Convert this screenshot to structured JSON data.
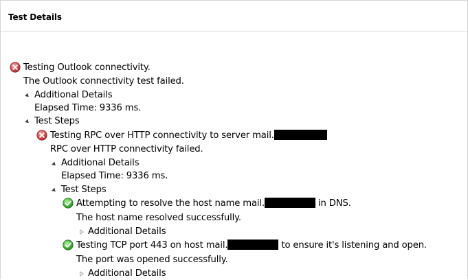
{
  "header": {
    "title": "Test Details"
  },
  "tree": {
    "root": {
      "title": "Testing Outlook connectivity.",
      "message": "The Outlook connectivity test failed.",
      "additional_details_label": "Additional Details",
      "elapsed": "Elapsed Time: 9336 ms.",
      "test_steps_label": "Test Steps",
      "status": "error"
    },
    "rpc": {
      "title_prefix": "Testing RPC over HTTP connectivity to server mail.",
      "message": "RPC over HTTP connectivity failed.",
      "additional_details_label": "Additional Details",
      "elapsed": "Elapsed Time: 9336 ms.",
      "test_steps_label": "Test Steps",
      "status": "error"
    },
    "dns_step": {
      "title_prefix": "Attempting to resolve the host name mail.",
      "title_suffix": " in DNS.",
      "message": "The host name resolved successfully.",
      "additional_details_label": "Additional Details",
      "status": "success"
    },
    "tcp_step": {
      "title_prefix": "Testing TCP port 443 on host mail.",
      "title_suffix": " to ensure it's listening and open.",
      "message": "The port was opened successfully.",
      "additional_details_label": "Additional Details",
      "status": "success"
    }
  },
  "colors": {
    "error_icon": "#d9534f",
    "success_icon": "#3ea63a",
    "redaction": "#000000",
    "expanded_arrow": "#404040",
    "collapsed_arrow": "#a8a8a8"
  },
  "icons": {
    "error": "error-x-icon",
    "success": "success-check-icon",
    "expanded": "expanded-triangle-icon",
    "collapsed": "collapsed-triangle-icon"
  }
}
